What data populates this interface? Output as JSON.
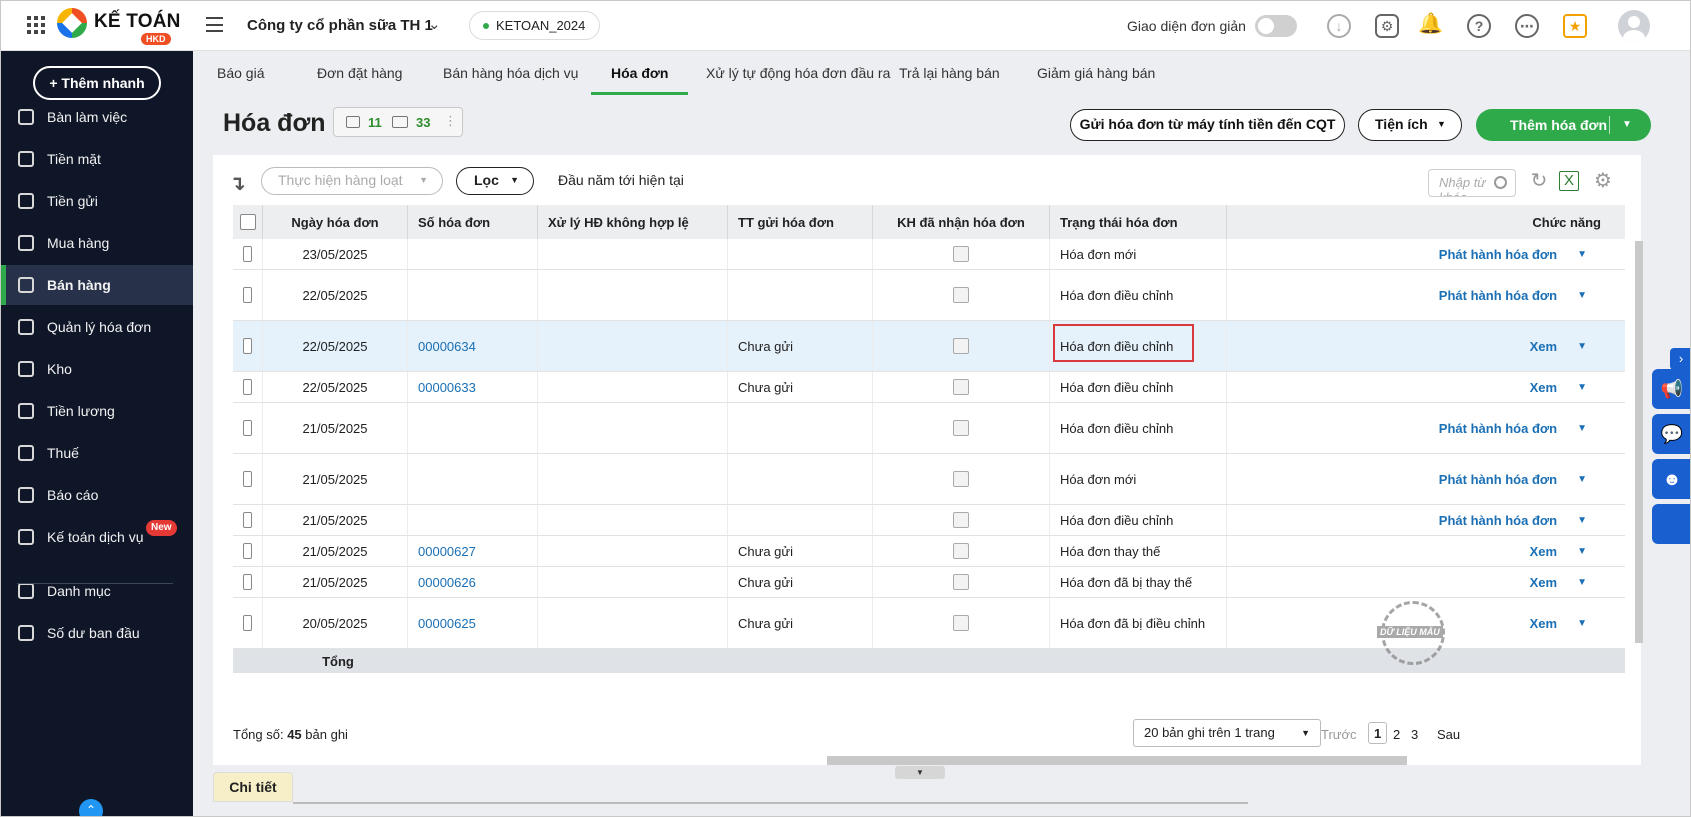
{
  "app": {
    "logo_text": "KẾ TOÁN",
    "logo_tag": "HKD",
    "company": "Công ty cổ phần sữa TH 1",
    "database": "KETOAN_2024",
    "simple_ui_label": "Giao diện đơn giản"
  },
  "sidebar": {
    "quick_add": "+ Thêm nhanh",
    "items": [
      {
        "label": "Bàn làm việc"
      },
      {
        "label": "Tiền mặt"
      },
      {
        "label": "Tiền gửi"
      },
      {
        "label": "Mua hàng"
      },
      {
        "label": "Bán hàng"
      },
      {
        "label": "Quản lý hóa đơn"
      },
      {
        "label": "Kho"
      },
      {
        "label": "Tiền lương"
      },
      {
        "label": "Thuế"
      },
      {
        "label": "Báo cáo"
      },
      {
        "label": "Kế toán dịch vụ",
        "badge": "New"
      },
      {
        "label": "Danh mục"
      },
      {
        "label": "Số dư ban đầu"
      }
    ],
    "active_index": 4
  },
  "tabs": [
    "Báo giá",
    "Đơn đặt hàng",
    "Bán hàng hóa dịch vụ",
    "Hóa đơn",
    "Xử lý tự động hóa đơn đầu ra",
    "Trả lại hàng bán",
    "Giảm giá hàng bán"
  ],
  "active_tab": 3,
  "page": {
    "title": "Hóa đơn",
    "count_docs": "11",
    "count_mail": "33",
    "btn_send": "Gửi hóa đơn từ máy tính tiền đến CQT",
    "btn_utility": "Tiện ích",
    "btn_add": "Thêm hóa đơn"
  },
  "toolbar": {
    "bulk": "Thực hiện hàng loạt",
    "filter": "Lọc",
    "range": "Đầu năm tới hiện tại",
    "search_placeholder": "Nhập từ khóa"
  },
  "table": {
    "headers": [
      "Ngày hóa đơn",
      "Số hóa đơn",
      "Xử lý HĐ không hợp lệ",
      "TT gửi hóa đơn",
      "KH đã nhận hóa đơn",
      "Trạng thái hóa đơn",
      "Chức năng"
    ],
    "rows": [
      {
        "date": "23/05/2025",
        "number": "",
        "send": "",
        "status": "Hóa đơn mới",
        "action": "Phát hành hóa đơn"
      },
      {
        "date": "22/05/2025",
        "number": "",
        "send": "",
        "status": "Hóa đơn điều chỉnh",
        "action": "Phát hành hóa đơn"
      },
      {
        "date": "22/05/2025",
        "number": "00000634",
        "send": "Chưa gửi",
        "status": "Hóa đơn điều chỉnh",
        "action": "Xem"
      },
      {
        "date": "22/05/2025",
        "number": "00000633",
        "send": "Chưa gửi",
        "status": "Hóa đơn điều chỉnh",
        "action": "Xem"
      },
      {
        "date": "21/05/2025",
        "number": "",
        "send": "",
        "status": "Hóa đơn điều chỉnh",
        "action": "Phát hành hóa đơn"
      },
      {
        "date": "21/05/2025",
        "number": "",
        "send": "",
        "status": "Hóa đơn mới",
        "action": "Phát hành hóa đơn"
      },
      {
        "date": "21/05/2025",
        "number": "",
        "send": "",
        "status": "Hóa đơn điều chỉnh",
        "action": "Phát hành hóa đơn"
      },
      {
        "date": "21/05/2025",
        "number": "00000627",
        "send": "Chưa gửi",
        "status": "Hóa đơn thay thế",
        "action": "Xem"
      },
      {
        "date": "21/05/2025",
        "number": "00000626",
        "send": "Chưa gửi",
        "status": "Hóa đơn đã bị thay thế",
        "action": "Xem"
      },
      {
        "date": "20/05/2025",
        "number": "00000625",
        "send": "Chưa gửi",
        "status": "Hóa đơn đã bị điều chỉnh",
        "action": "Xem"
      }
    ],
    "highlight_row": 2,
    "sum_label": "Tổng",
    "watermark": "DỮ LIỆU MẪU"
  },
  "footer": {
    "total_prefix": "Tổng số: ",
    "total_count": "45",
    "total_suffix": " bản ghi",
    "page_size": "20 bản ghi trên 1 trang",
    "prev": "Trước",
    "pages": [
      "1",
      "2",
      "3"
    ],
    "next": "Sau",
    "detail_tab": "Chi tiết"
  }
}
